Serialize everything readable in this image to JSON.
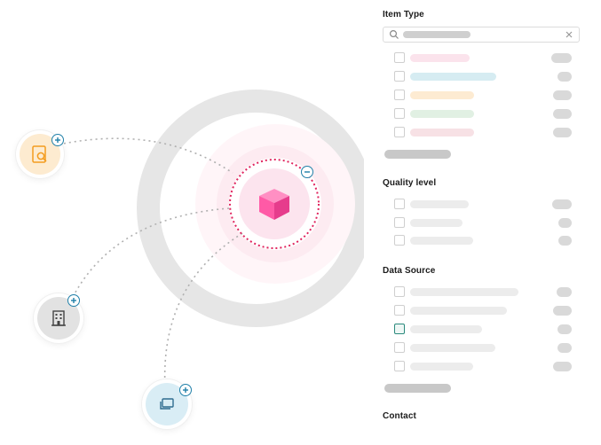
{
  "graph": {
    "center_node": {
      "icon": "cube-icon",
      "color": "#f24b97",
      "badge": "minus-badge"
    },
    "nodes": [
      {
        "icon": "document-search-icon",
        "color": "#f5a936",
        "badge": "plus-badge"
      },
      {
        "icon": "building-icon",
        "color": "#555555",
        "badge": "plus-badge"
      },
      {
        "icon": "screens-icon",
        "color": "#2f6d8f",
        "badge": "plus-badge"
      }
    ]
  },
  "filters": {
    "search": {
      "icons": [
        "search-icon",
        "clear-icon"
      ]
    },
    "sections": [
      {
        "title": "Item Type",
        "pill_colors": [
          "#fbe3ec",
          "#d6ecf2",
          "#fdebd2",
          "#e1f0e3",
          "#f7e1e5"
        ],
        "has_more": true
      },
      {
        "title": "Quality level",
        "pill_colors": [
          "#ececec",
          "#ececec",
          "#ececec"
        ],
        "has_more": false
      },
      {
        "title": "Data Source",
        "pill_colors": [
          "#ececec",
          "#ececec",
          "#ececec",
          "#ececec",
          "#ececec"
        ],
        "has_more": true
      },
      {
        "title": "Contact"
      }
    ]
  },
  "colors": {
    "accent": "#1f7fa8",
    "center": "#f24b97",
    "highlight_checkbox": "#2b8a7d"
  }
}
